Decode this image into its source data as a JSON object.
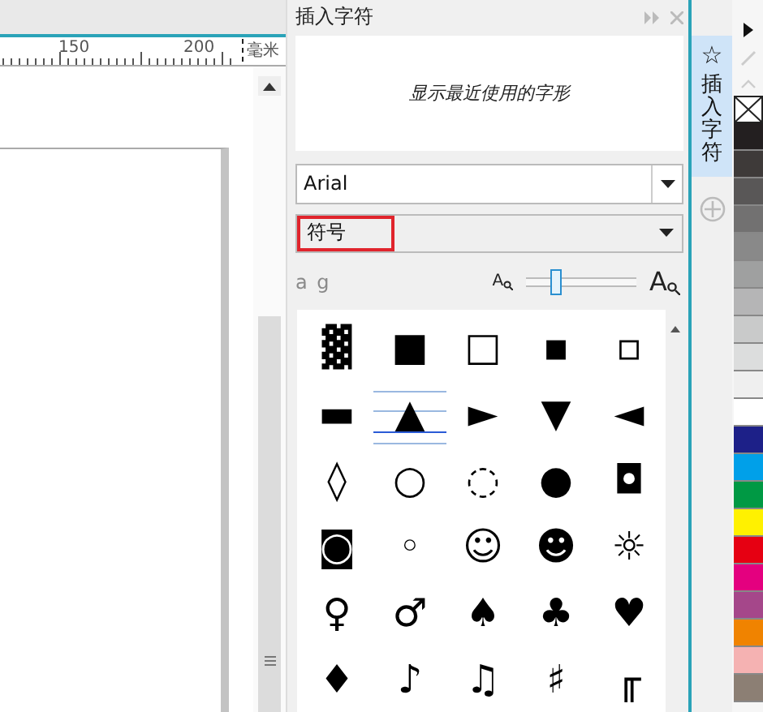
{
  "ruler": {
    "labels": [
      "150",
      "200"
    ],
    "unit": "毫米"
  },
  "panel": {
    "title": "插入字符",
    "recent_hint": "显示最近使用的字形",
    "font": "Arial",
    "subset": {
      "label": "符号",
      "highlighted": true
    },
    "preview_label": "a g",
    "zoom_out_label": "A",
    "zoom_in_label": "A",
    "zoom": {
      "level": 0.28
    },
    "glyphs": [
      {
        "char": "▓",
        "selected": false
      },
      {
        "char": "■",
        "selected": false
      },
      {
        "char": "□",
        "selected": false
      },
      {
        "char": "▪",
        "selected": false
      },
      {
        "char": "▫",
        "selected": false
      },
      {
        "char": "▬",
        "selected": false
      },
      {
        "char": "▲",
        "selected": true
      },
      {
        "char": "►",
        "selected": false
      },
      {
        "char": "▼",
        "selected": false
      },
      {
        "char": "◄",
        "selected": false
      },
      {
        "char": "◊",
        "selected": false
      },
      {
        "char": "○",
        "selected": false
      },
      {
        "char": "◌",
        "selected": false
      },
      {
        "char": "●",
        "selected": false
      },
      {
        "char": "◘",
        "selected": false
      },
      {
        "char": "◙",
        "selected": false
      },
      {
        "char": "◦",
        "selected": false
      },
      {
        "char": "☺",
        "selected": false
      },
      {
        "char": "☻",
        "selected": false
      },
      {
        "char": "☼",
        "selected": false
      },
      {
        "char": "♀",
        "selected": false
      },
      {
        "char": "♂",
        "selected": false
      },
      {
        "char": "♠",
        "selected": false
      },
      {
        "char": "♣",
        "selected": false
      },
      {
        "char": "♥",
        "selected": false
      },
      {
        "char": "♦",
        "selected": false
      },
      {
        "char": "♪",
        "selected": false
      },
      {
        "char": "♫",
        "selected": false
      },
      {
        "char": "♯",
        "selected": false
      },
      {
        "char": "╓",
        "selected": false
      }
    ]
  },
  "docker_tab": {
    "icon": "☆",
    "label": "插入字符",
    "selected": true
  },
  "palette": [
    {
      "color": "#231f20"
    },
    {
      "color": "#3e3a39"
    },
    {
      "color": "#595757"
    },
    {
      "color": "#727171"
    },
    {
      "color": "#898989"
    },
    {
      "color": "#9fa0a0"
    },
    {
      "color": "#b5b5b6"
    },
    {
      "color": "#c9caca"
    },
    {
      "color": "#dcdddd"
    },
    {
      "color": "#efefef"
    },
    {
      "color": "#ffffff"
    },
    {
      "color": "#1d2088"
    },
    {
      "color": "#00a0e9"
    },
    {
      "color": "#009944"
    },
    {
      "color": "#fff100"
    },
    {
      "color": "#e60012"
    },
    {
      "color": "#e4007f"
    },
    {
      "color": "#a5478a"
    },
    {
      "color": "#f08300"
    },
    {
      "color": "#f5b2b2"
    },
    {
      "color": "#8c7f74"
    }
  ]
}
